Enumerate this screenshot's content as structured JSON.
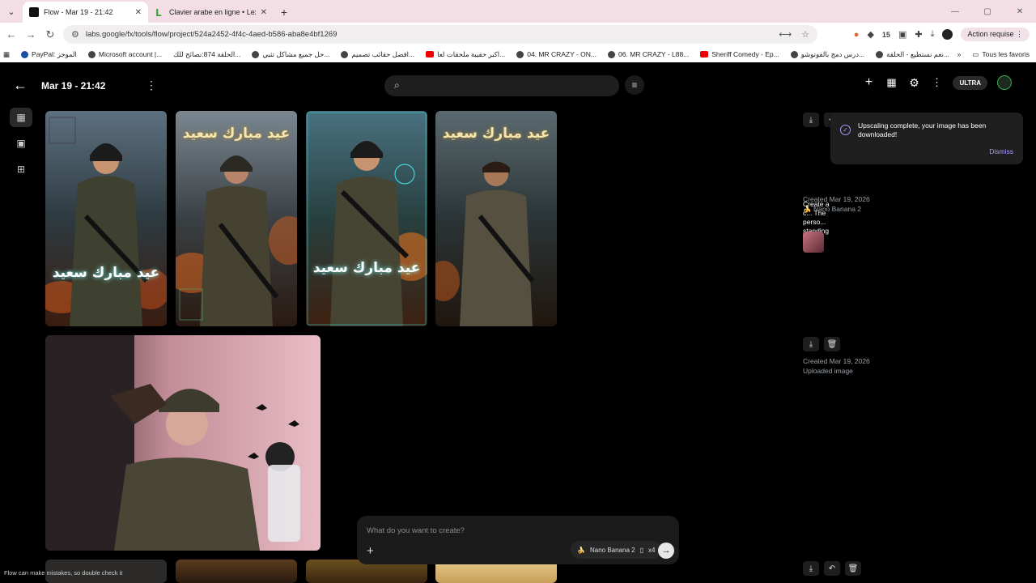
{
  "browser": {
    "tabs": [
      {
        "title": "Flow - Mar 19 - 21:42",
        "active": true
      },
      {
        "title": "Clavier arabe en ligne • Lexilog",
        "active": false
      }
    ],
    "url_scheme": "labs.google",
    "url": "labs.google/fx/tools/flow/project/524a2452-4f4c-4aed-b586-aba8e4bf1269",
    "extension_badge": "15",
    "action_required": "Action requise",
    "bookmarks": [
      "PayPal: الموجز",
      "Microsoft account |...",
      "الحلقة 874:نصائح للك...",
      "حل جميع مشاكل تثبي...",
      "افضل حقائب تصميم...",
      "اكبر حقيبة ملحقات لعا...",
      "04. MR CRAZY - ON...",
      "06. MR CRAZY - L88...",
      "Sheriff Comedy - Ep...",
      "درس دمج بالفوتوشو...",
      "نعم نستطيع - الحلقة..."
    ],
    "all_favorites": "Tous les favoris"
  },
  "app": {
    "project_title": "Mar 19 - 21:42",
    "plan_badge": "ULTRA",
    "grid_overlay_text": "عيد مبارك سعيد",
    "toast": {
      "message": "Upscaling complete, your image has been downloaded!",
      "dismiss": "Dismiss"
    },
    "details1": {
      "description": "Create a c... The perso... standing c...",
      "created": "Created Mar 19, 2026",
      "model": "Nano Banana 2"
    },
    "details2": {
      "created": "Created Mar 19, 2026",
      "source": "Uploaded image"
    },
    "prompt": {
      "placeholder": "What do you want to create?",
      "model": "Nano Banana 2",
      "count": "x4"
    },
    "disclaimer": "Flow can make mistakes, so double check it"
  },
  "colors": {
    "accent": "#a59bff",
    "background": "#000000",
    "tabbar": "#f3dee6"
  }
}
